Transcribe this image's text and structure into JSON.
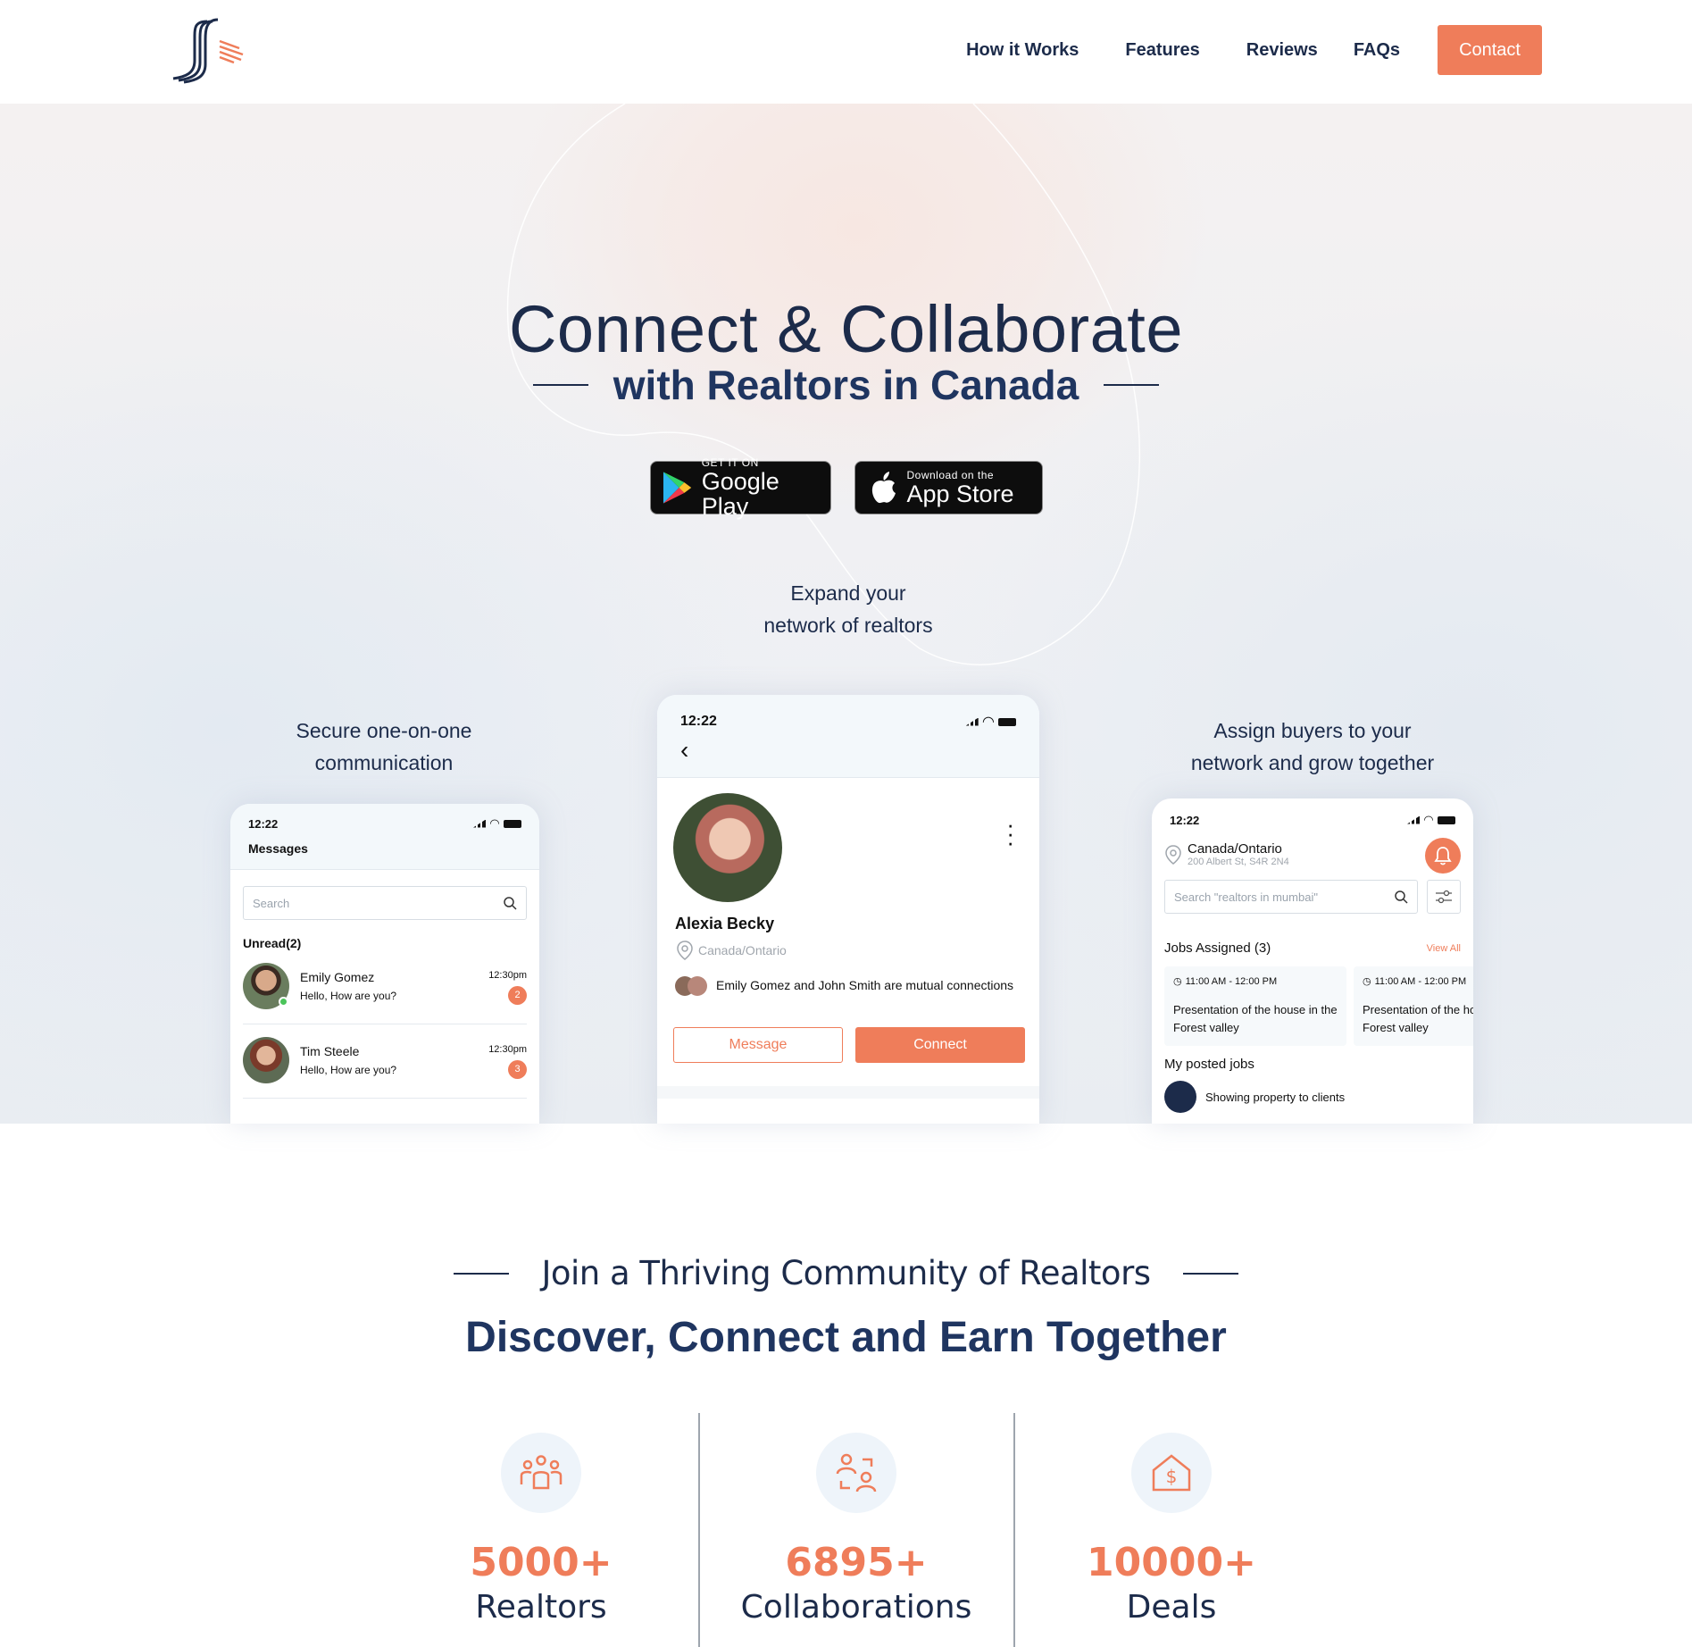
{
  "header": {
    "nav": [
      "How it Works",
      "Features",
      "Reviews",
      "FAQs"
    ],
    "contact_label": "Contact"
  },
  "hero": {
    "title": "Connect & Collaborate",
    "subtitle": "with Realtors in Canada",
    "google_play": {
      "small": "GET IT ON",
      "big": "Google Play"
    },
    "app_store": {
      "small": "Download on the",
      "big": "App Store"
    },
    "caption_center": [
      "Expand your",
      "network of realtors"
    ],
    "caption_left": [
      "Secure one-on-one",
      "communication"
    ],
    "caption_right": [
      "Assign buyers to your",
      "network and grow together"
    ]
  },
  "phone_messages": {
    "time": "12:22",
    "title": "Messages",
    "search_placeholder": "Search",
    "unread_label": "Unread(2)",
    "chats": [
      {
        "name": "Emily Gomez",
        "message": "Hello, How are you?",
        "time": "12:30pm",
        "count": "2"
      },
      {
        "name": "Tim Steele",
        "message": "Hello, How are you?",
        "time": "12:30pm",
        "count": "3"
      }
    ]
  },
  "phone_profile": {
    "time": "12:22",
    "name": "Alexia Becky",
    "location": "Canada/Ontario",
    "mutual": "Emily Gomez and John Smith are mutual connections",
    "message_label": "Message",
    "connect_label": "Connect"
  },
  "phone_jobs": {
    "time": "12:22",
    "city": "Canada/Ontario",
    "address": "200 Albert St, S4R 2N4",
    "search_placeholder": "Search \"realtors in mumbai\"",
    "jobs_assigned": "Jobs Assigned (3)",
    "view_all": "View All",
    "jobs": [
      {
        "time": "11:00 AM - 12:00 PM",
        "desc": "Presentation of the house in the Forest valley"
      },
      {
        "time": "11:00 AM - 12:00 PM",
        "desc": "Presentation of the house in the Forest valley"
      }
    ],
    "posted_label": "My posted jobs",
    "posted_item": "Showing property to clients"
  },
  "community": {
    "kicker": "Join a Thriving Community of Realtors",
    "heading": "Discover, Connect and Earn Together",
    "stats": [
      {
        "number": "5000+",
        "label": "Realtors",
        "icon": "group-icon"
      },
      {
        "number": "6895+",
        "label": "Collaborations",
        "icon": "collaboration-icon"
      },
      {
        "number": "10000+",
        "label": "Deals",
        "icon": "house-dollar-icon"
      }
    ]
  },
  "colors": {
    "accent": "#ef7d5a",
    "navy": "#1c2b4a"
  }
}
